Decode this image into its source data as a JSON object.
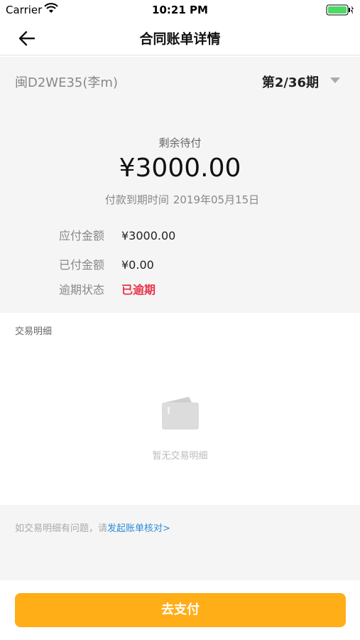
{
  "status_bar": {
    "carrier": "Carrier",
    "time": "10:21 PM"
  },
  "nav": {
    "title": "合同账单详情"
  },
  "summary": {
    "plate": "闽D2WE35(李m)",
    "period": "第2/36期",
    "remain_label": "剩余待付",
    "remain_amount": "¥3000.00",
    "due_label": "付款到期时间",
    "due_date": "2019年05月15日",
    "rows": [
      {
        "key": "应付金额",
        "value": "¥3000.00"
      },
      {
        "key": "已付金额",
        "value": "¥0.00"
      },
      {
        "key": "逾期状态",
        "value": "已逾期"
      }
    ]
  },
  "transactions": {
    "label": "交易明细",
    "empty_text": "暂无交易明细"
  },
  "help": {
    "prefix": "如交易明细有问题，请",
    "link": "发起账单核对>"
  },
  "footer": {
    "pay_label": "去支付"
  },
  "colors": {
    "accent": "#ffae18",
    "overdue": "#e8334a",
    "link": "#2a8cdb"
  }
}
